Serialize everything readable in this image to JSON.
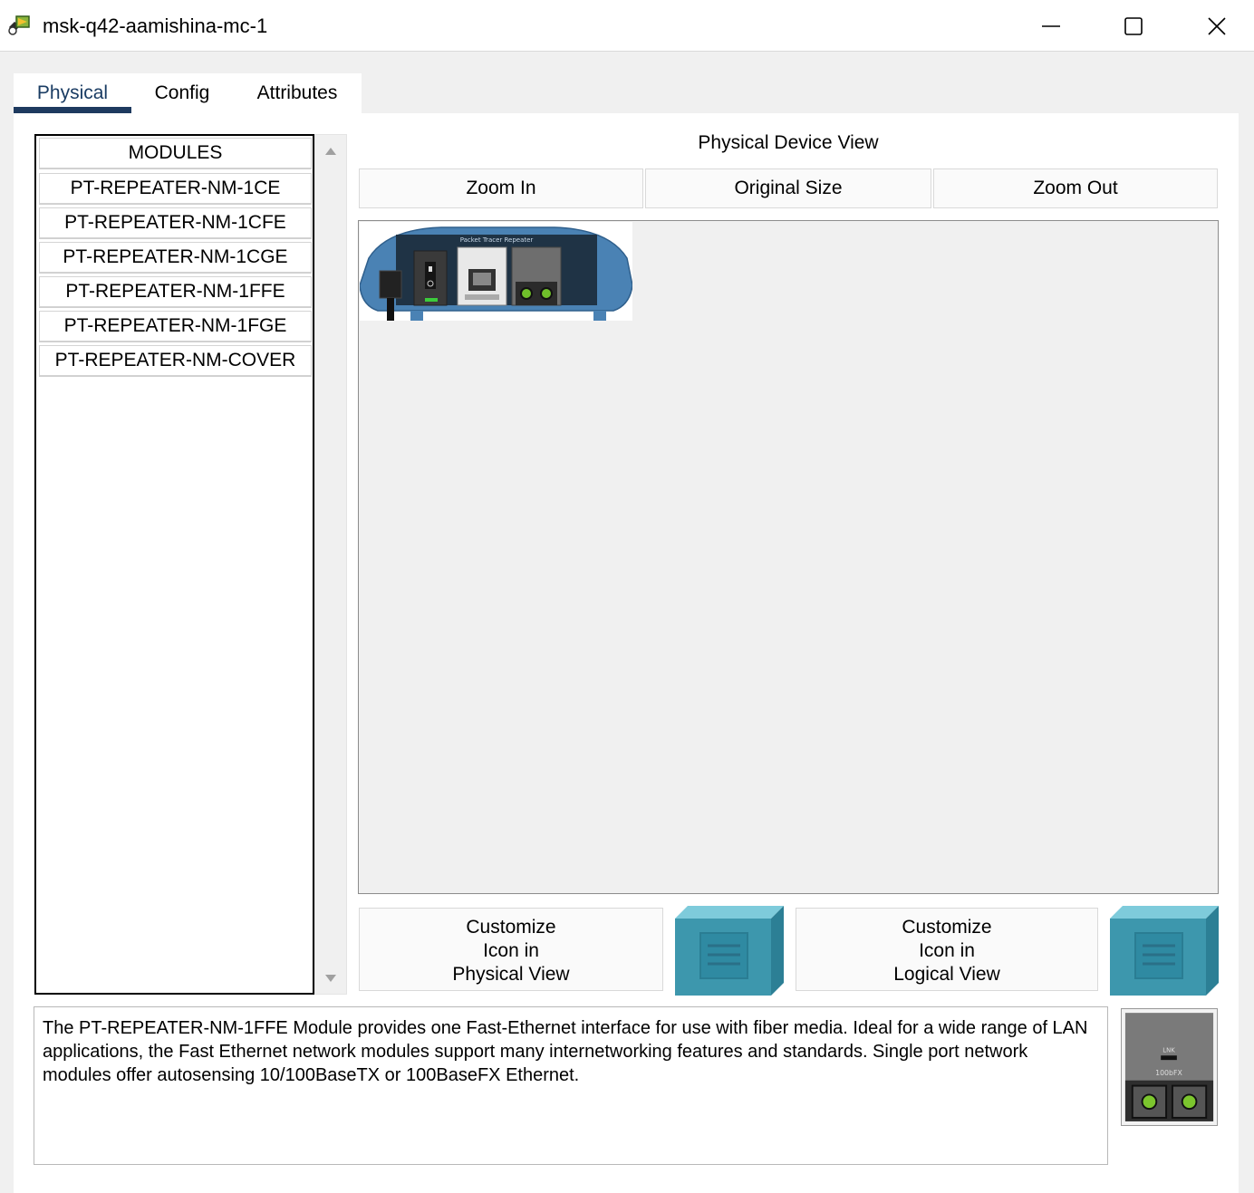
{
  "window": {
    "title": "msk-q42-aamishina-mc-1"
  },
  "tabs": [
    {
      "label": "Physical",
      "active": true
    },
    {
      "label": "Config",
      "active": false
    },
    {
      "label": "Attributes",
      "active": false
    }
  ],
  "modules": {
    "header": "MODULES",
    "items": [
      "PT-REPEATER-NM-1CE",
      "PT-REPEATER-NM-1CFE",
      "PT-REPEATER-NM-1CGE",
      "PT-REPEATER-NM-1FFE",
      "PT-REPEATER-NM-1FGE",
      "PT-REPEATER-NM-COVER"
    ]
  },
  "physical_view": {
    "title": "Physical Device View",
    "zoom_in": "Zoom In",
    "original_size": "Original Size",
    "zoom_out": "Zoom Out",
    "device_label": "Packet Tracer Repeater"
  },
  "customize": {
    "physical": {
      "line1": "Customize",
      "line2": "Icon in",
      "line3": "Physical View"
    },
    "logical": {
      "line1": "Customize",
      "line2": "Icon in",
      "line3": "Logical View"
    }
  },
  "description": "The PT-REPEATER-NM-1FFE Module provides one Fast-Ethernet interface for use with fiber media. Ideal for a wide range of LAN applications, the Fast Ethernet network modules support many internetworking features and standards. Single port network modules offer autosensing 10/100BaseTX or 100BaseFX Ethernet.",
  "module_thumb": {
    "link_label": "LNK",
    "port_label": "100bFX"
  },
  "colors": {
    "tab_underline": "#1e3a5f",
    "cube": "#3d97ad",
    "device_body": "#4a82b4"
  },
  "icons": {
    "app": "packet-tracer-device-icon",
    "minimize": "minimize-icon",
    "maximize": "maximize-icon",
    "close": "close-icon"
  }
}
